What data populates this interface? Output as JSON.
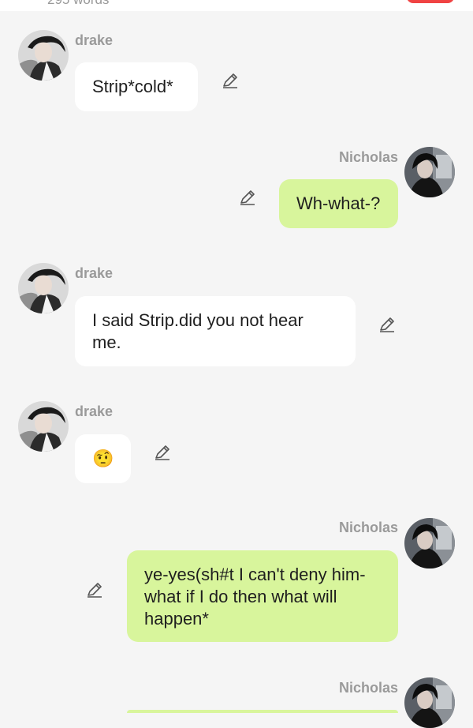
{
  "header": {
    "word_count": "295 words"
  },
  "users": {
    "drake": {
      "name": "drake"
    },
    "nicholas": {
      "name": "Nicholas"
    }
  },
  "messages": [
    {
      "sender": "drake",
      "text": "Strip*cold*"
    },
    {
      "sender": "Nicholas",
      "text": "Wh-what-?"
    },
    {
      "sender": "drake",
      "text": "I said Strip.did you not hear me."
    },
    {
      "sender": "drake",
      "text": "🤨"
    },
    {
      "sender": "Nicholas",
      "text": "ye-yes(sh#t I can't deny him-what if I do then what will happen*"
    },
    {
      "sender": "Nicholas",
      "text": ""
    }
  ],
  "colors": {
    "background": "#f5f5f5",
    "left_bubble": "#ffffff",
    "right_bubble": "#d8f59c",
    "name_text": "#9a9a9a"
  },
  "icons": {
    "edit": "pencil-edit-icon"
  }
}
